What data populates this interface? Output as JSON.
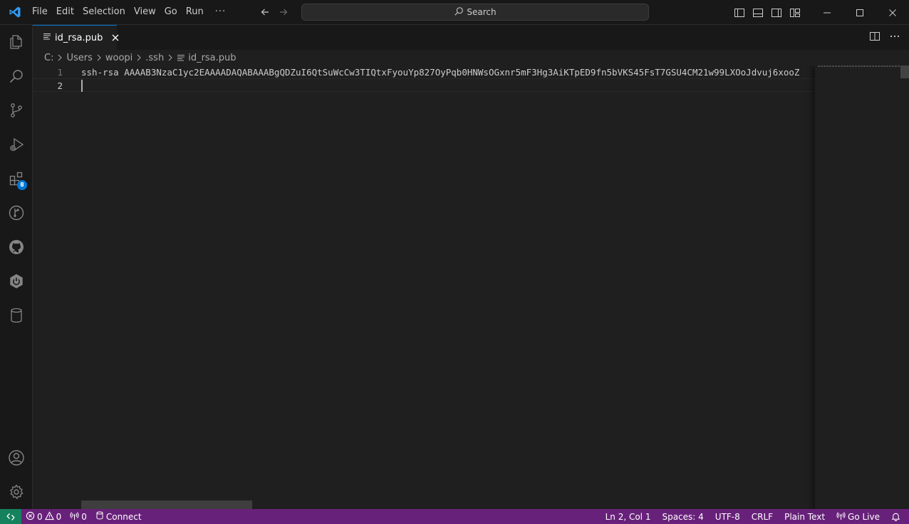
{
  "titlebar": {
    "menu": [
      "File",
      "Edit",
      "Selection",
      "View",
      "Go",
      "Run",
      "···"
    ],
    "search_placeholder": "Search",
    "icons": [
      "vscode-logo-icon",
      "arrow-left-icon",
      "arrow-right-icon",
      "search-icon",
      "toggle-primary-sidebar-icon",
      "toggle-panel-icon",
      "toggle-secondary-sidebar-icon",
      "customize-layout-icon",
      "minimize-icon",
      "maximize-icon",
      "close-icon"
    ]
  },
  "activitybar": {
    "items": [
      "explorer-icon",
      "search-icon",
      "source-control-icon",
      "run-debug-icon",
      "extensions-icon",
      "git-graph-icon",
      "github-icon",
      "spring-boot-icon",
      "database-icon"
    ],
    "extensions_badge": "8",
    "bottom": [
      "accounts-icon",
      "manage-gear-icon"
    ]
  },
  "tab": {
    "label": "id_rsa.pub"
  },
  "breadcrumb": {
    "items": [
      "C:",
      "Users",
      "woopi",
      ".ssh",
      "id_rsa.pub"
    ]
  },
  "editor": {
    "lines": [
      {
        "number": "1",
        "text": "ssh-rsa AAAAB3NzaC1yc2EAAAADAQABAAABgQDZuI6QtSuWcCw3TIQtxFyouYp827OyPqb0HNWsOGxnr5mF3Hg3AiKTpED9fn5bVKS45FsT7GSU4CM21w99LXOoJdvuj6xooZ"
      },
      {
        "number": "2",
        "text": ""
      }
    ]
  },
  "statusbar": {
    "errors": "0",
    "warnings": "0",
    "ports": "0",
    "connect": "Connect",
    "position": "Ln 2, Col 1",
    "spaces": "Spaces: 4",
    "encoding": "UTF-8",
    "eol": "CRLF",
    "language": "Plain Text",
    "golive": "Go Live"
  },
  "colors": {
    "statusbar_bg": "#68217a",
    "remote_bg": "#16825d",
    "accent": "#0078d4"
  }
}
